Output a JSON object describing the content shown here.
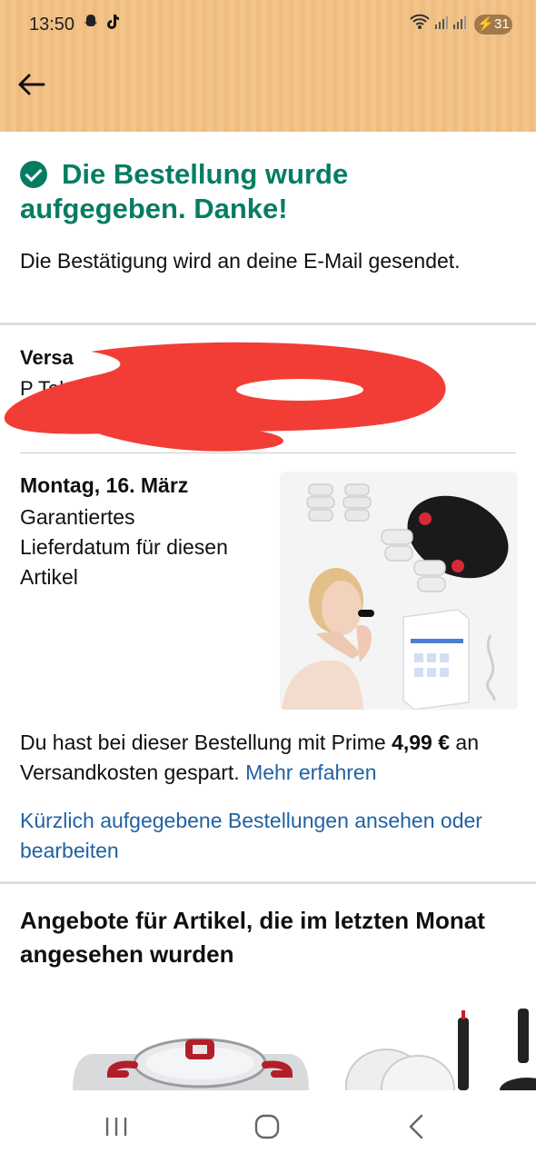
{
  "status_bar": {
    "time": "13:50",
    "battery": "31",
    "icons": [
      "snapchat-icon",
      "tiktok-icon",
      "wifi-icon",
      "signal-icon",
      "signal-icon",
      "battery-charging-icon"
    ]
  },
  "confirmation": {
    "title": "Die Bestellung wurde aufgegeben. Danke!",
    "subtitle": "Die Bestätigung wird an deine E-Mail gesendet."
  },
  "shipping": {
    "label": "Versa",
    "line": "P                         Telefonnu    me"
  },
  "delivery": {
    "date": "Montag, 16. März",
    "text": "Garantiertes Lieferdatum für diesen Artikel"
  },
  "savings": {
    "prefix": "Du hast bei dieser Bestellung mit Prime ",
    "amount": "4,99 €",
    "suffix": " an Versandkosten gespart. ",
    "link": "Mehr erfahren"
  },
  "orders_link": "Kürzlich aufgegebene Bestellungen ansehen oder bearbeiten",
  "offers": {
    "title": "Angebote für Artikel, die im letzten Monat angesehen wurden"
  },
  "colors": {
    "success_green": "#067d62",
    "link_blue": "#2162a1",
    "header_bg": "#f3c48a",
    "redaction_red": "#f23d36"
  }
}
